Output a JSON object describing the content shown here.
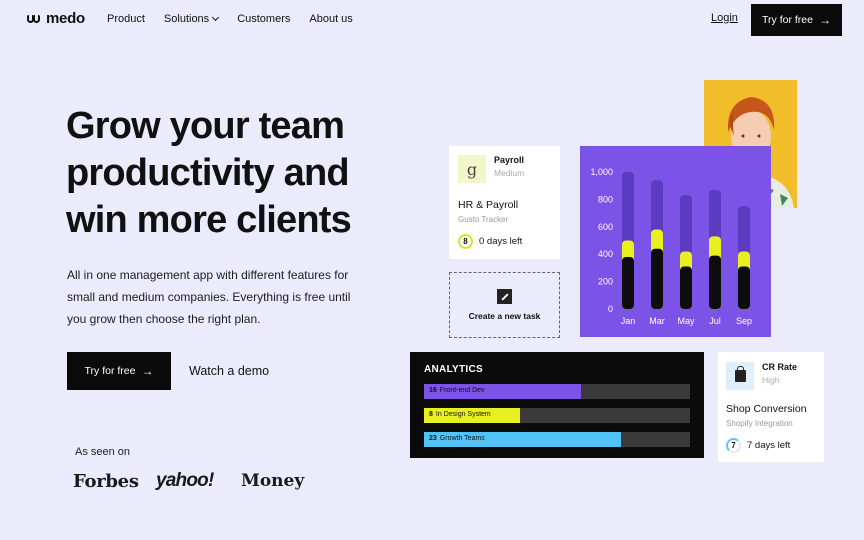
{
  "nav": {
    "logo": "medo",
    "items": [
      {
        "label": "Product"
      },
      {
        "label": "Solutions",
        "dropdown": true
      },
      {
        "label": "Customers"
      },
      {
        "label": "About us"
      }
    ],
    "login": "Login",
    "cta": "Try for free"
  },
  "hero": {
    "headline": "Grow your team productivity and win more clients",
    "subtext": "All in one management app with different features for small and medium companies. Everything is free until you grow then choose the right plan.",
    "cta": "Try for free",
    "demo": "Watch a demo",
    "seen_on": "As seen on",
    "brands": [
      "Forbes",
      "yahoo!",
      "Money"
    ]
  },
  "payroll_card": {
    "badge": "g",
    "title": "Payroll",
    "priority": "Medium",
    "heading": "HR & Payroll",
    "meta": "Gusto Tracker",
    "days_num": "8",
    "days_text": "0 days left"
  },
  "new_task": {
    "label": "Create a new task"
  },
  "chart_data": {
    "type": "bar",
    "categories": [
      "Jan",
      "Mar",
      "May",
      "Jul",
      "Sep"
    ],
    "y_ticks": [
      "1,000",
      "800",
      "600",
      "400",
      "200",
      "0"
    ],
    "ylim": [
      0,
      1000
    ],
    "series": [
      {
        "values": [
          380,
          440,
          310,
          390,
          310
        ],
        "color": "#0d0d0d"
      },
      {
        "values": [
          500,
          580,
          420,
          530,
          420
        ],
        "color": "#e8f020"
      },
      {
        "values": [
          1000,
          940,
          830,
          870,
          750
        ],
        "color": "#5b3bc0"
      }
    ]
  },
  "analytics": {
    "title": "ANALYTICS",
    "rows": [
      {
        "num": "16",
        "label": "Front-end Dev",
        "fraction": 0.59,
        "color": "#7b53e6"
      },
      {
        "num": "8",
        "label": "In Design System",
        "fraction": 0.36,
        "color": "#e8f020"
      },
      {
        "num": "23",
        "label": "Growth Teams",
        "fraction": 0.74,
        "color": "#4fc3f7"
      }
    ]
  },
  "cr_card": {
    "title": "CR Rate",
    "priority": "High",
    "heading": "Shop Conversion",
    "meta": "Shopify Integration",
    "days_num": "7",
    "days_text": "7 days left"
  }
}
